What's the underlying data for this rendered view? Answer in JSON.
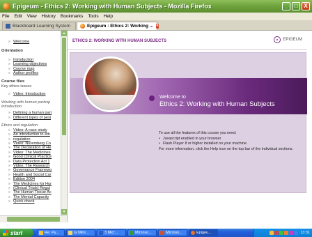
{
  "window": {
    "title": "Epigeum - Ethics 2: Working with Human Subjects - Mozilla Firefox",
    "buttons": [
      "_",
      "□",
      "X"
    ]
  },
  "menu": [
    "File",
    "Edit",
    "View",
    "History",
    "Bookmarks",
    "Tools",
    "Help"
  ],
  "tabs": [
    {
      "label": "Blackboard Learning System",
      "active": false
    },
    {
      "label": "Epigeum : Ethics 2: Working ...",
      "active": true
    }
  ],
  "sidebar": {
    "welcome": "Welcome",
    "orientation_heading": "Orientation",
    "orientation_items": [
      "Introduction",
      "Learning objectives",
      "Course map",
      "Author profiles"
    ],
    "course_files_heading": "Course files",
    "course_files_sub": "Key ethics issues",
    "course_files_items": [
      "Video: Introduction"
    ],
    "working_heading_1": "Working with human particip",
    "working_heading_2": "introduction",
    "working_items": [
      "Defining a human part",
      "Different types of pesi"
    ],
    "ethics_heading": "Ethics and regulation",
    "ethics_items": [
      "Video: A case study",
      "An introduction to eth",
      "regulation",
      "Video: Nuremberg Co",
      "The Declaration of He",
      "Video: The Medicines",
      "Good Clinical Practice",
      "Data Protection Act 1",
      "Video: The Research",
      "Governance Framewo",
      "Health and Social Car",
      "Edition 2004",
      "The Medicines for Hur",
      "(Clinical Trials) Regul",
      "The Human Tissue Ac",
      "The Mental Capacity",
      "Quick check"
    ]
  },
  "main": {
    "heading": "ETHICS 2: WORKING WITH HUMAN SUBJECTS",
    "logo": "EPIGEUM",
    "welcome_line1": "Welcome to",
    "welcome_line2": "Ethics 2: Working with Human Subjects",
    "info_line1": "To use all the features of this course you need:",
    "info_bullet1": "Javascript enabled in your browser",
    "info_bullet2": "Flash Player 8 or higher installed on your machine.",
    "info_line2": "For more information, click the Help icon on the top bar of the individual sections."
  },
  "taskbar": {
    "start": "start",
    "tasks": [
      "Re: Py...",
      "G:\\Wor...",
      "3 Micr...",
      "Microso...",
      "Microso...",
      "Epigeu..."
    ],
    "clock": "13:31"
  },
  "colors": {
    "titlebar": "#6ea23c",
    "accent_purple": "#7b2a86",
    "panel_bg": "#ddd0e2"
  }
}
